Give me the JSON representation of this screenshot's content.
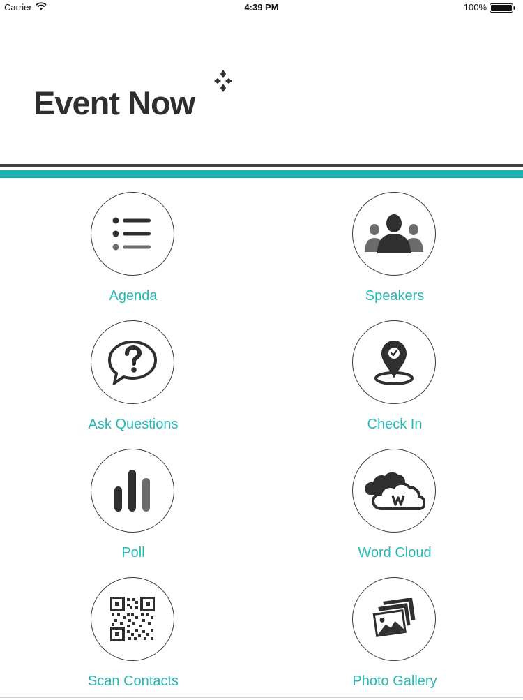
{
  "status_bar": {
    "carrier": "Carrier",
    "time": "4:39 PM",
    "battery": "100%"
  },
  "header": {
    "logo_text": "Event Now"
  },
  "colors": {
    "accent_teal": "#1ab5b3",
    "label_teal": "#27b8b6",
    "dark_rule": "#3f4243",
    "icon_dark": "#2f2f30"
  },
  "menu": {
    "items": [
      {
        "label": "Agenda",
        "icon": "list-icon"
      },
      {
        "label": "Speakers",
        "icon": "people-icon"
      },
      {
        "label": "Ask Questions",
        "icon": "question-bubble-icon"
      },
      {
        "label": "Check In",
        "icon": "map-pin-check-icon"
      },
      {
        "label": "Poll",
        "icon": "bar-chart-icon"
      },
      {
        "label": "Word Cloud",
        "icon": "cloud-icon"
      },
      {
        "label": "Scan Contacts",
        "icon": "qr-code-icon"
      },
      {
        "label": "Photo Gallery",
        "icon": "photos-icon"
      }
    ]
  }
}
